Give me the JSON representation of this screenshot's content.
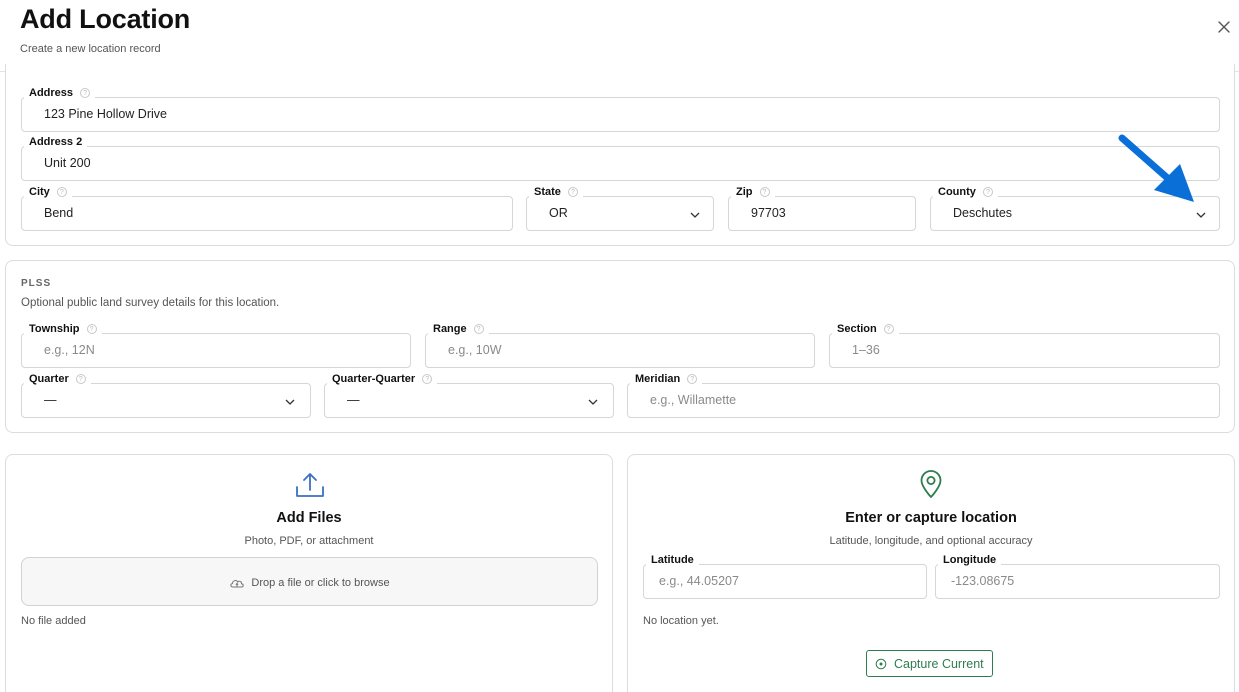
{
  "header": {
    "title": "Add Location",
    "subtitle": "Create a new location record"
  },
  "address": {
    "address": {
      "label": "Address",
      "value": "123 Pine Hollow Drive"
    },
    "address2": {
      "label": "Address 2",
      "value": "Unit 200"
    },
    "city": {
      "label": "City",
      "value": "Bend"
    },
    "state": {
      "label": "State",
      "value": "OR"
    },
    "zip": {
      "label": "Zip",
      "value": "97703"
    },
    "county": {
      "label": "County",
      "value": "Deschutes"
    }
  },
  "plss": {
    "kicker": "PLSS",
    "description": "Optional public land survey details for this location.",
    "township": {
      "label": "Township",
      "placeholder": "e.g., 12N"
    },
    "range": {
      "label": "Range",
      "placeholder": "e.g., 10W"
    },
    "section": {
      "label": "Section",
      "placeholder": "1–36"
    },
    "quarter": {
      "label": "Quarter",
      "value": "—"
    },
    "quarter_quarter": {
      "label": "Quarter-Quarter",
      "value": "—"
    },
    "meridian": {
      "label": "Meridian",
      "placeholder": "e.g., Willamette"
    }
  },
  "files": {
    "title": "Add Files",
    "subtitle": "Photo, PDF, or attachment",
    "drop_text": "Drop a file or click to browse",
    "status": "No file added"
  },
  "location": {
    "title": "Enter or capture location",
    "subtitle": "Latitude, longitude, and optional accuracy",
    "latitude": {
      "label": "Latitude",
      "placeholder": "e.g., 44.05207"
    },
    "longitude": {
      "label": "Longitude",
      "placeholder": "-123.08675"
    },
    "status": "No location yet.",
    "capture_label": "Capture Current"
  },
  "colors": {
    "accent_green": "#2f7d4f",
    "upload_blue": "#3b6fc4",
    "annotation_arrow": "#0a6fd6"
  },
  "icons": [
    "close-icon",
    "help-icon",
    "chevron-down-icon",
    "upload-icon",
    "cloud-upload-icon",
    "map-pin-icon",
    "crosshair-icon",
    "annotation-arrow"
  ]
}
